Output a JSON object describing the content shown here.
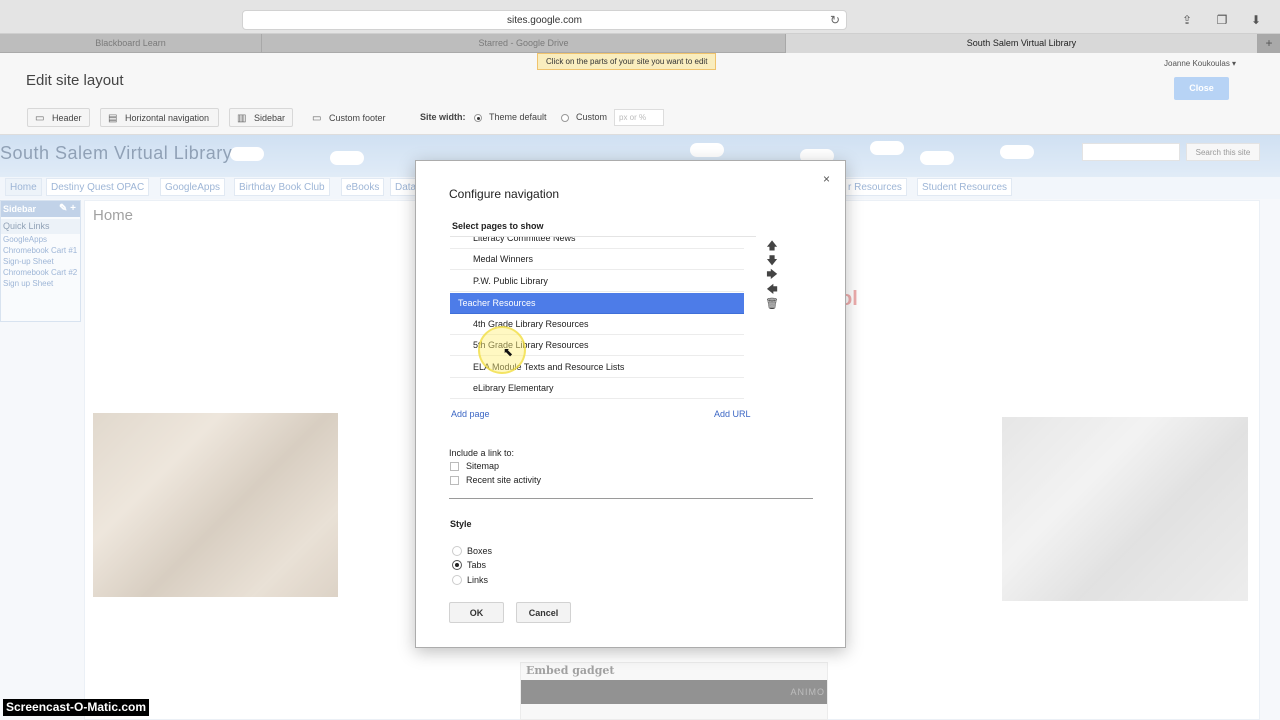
{
  "browser": {
    "url": "sites.google.com",
    "tabs": [
      "Blackboard Learn",
      "Starred - Google Drive",
      "South Salem Virtual Library"
    ],
    "icons": [
      "reload-icon",
      "share-icon",
      "window-icon",
      "download-icon"
    ]
  },
  "edit_bar": {
    "title": "Edit site layout",
    "tooltip": "Click on the parts of your site you want to edit",
    "user": "Joanne Koukoulas ▾",
    "close": "Close",
    "tools": [
      "Header",
      "Horizontal navigation",
      "Sidebar",
      "Custom footer"
    ],
    "site_width_label": "Site width:",
    "width_options": [
      "Theme default",
      "Custom"
    ],
    "width_selected": "Theme default",
    "width_placeholder": "px or %"
  },
  "site": {
    "title": "South Salem Virtual Library",
    "search_button": "Search this site",
    "nav_left": [
      "Home",
      "Destiny Quest OPAC",
      "GoogleApps",
      "Birthday Book Club",
      "eBooks",
      "Data"
    ],
    "nav_right": [
      "r Resources",
      "Student Resources"
    ],
    "sidebar_title": "Sidebar",
    "sidebar_edit": "✎ +",
    "quick_links_title": "Quick Links",
    "quick_links": [
      "GoogleApps",
      "Chromebook Cart #1 Sign-up Sheet",
      "Chromebook Cart #2 Sign up Sheet"
    ],
    "page_title": "Home",
    "fragment": "ol",
    "gadget_title": "Embed gadget",
    "gadget_logo": "ANIMO"
  },
  "dialog": {
    "title": "Configure navigation",
    "close": "×",
    "select_label": "Select pages to show",
    "pages": [
      {
        "label": "Literacy Committee News",
        "selected": false
      },
      {
        "label": "Medal Winners",
        "selected": false
      },
      {
        "label": "P.W. Public Library",
        "selected": false
      },
      {
        "label": "Teacher Resources",
        "selected": true
      },
      {
        "label": "4th Grade Library Resources",
        "selected": false
      },
      {
        "label": "5th Grade Library Resources",
        "selected": false
      },
      {
        "label": "ELA Module Texts and Resource Lists",
        "selected": false
      },
      {
        "label": "eLibrary Elementary",
        "selected": false
      }
    ],
    "arrows": [
      "move-up-icon",
      "move-down-icon",
      "indent-icon",
      "outdent-icon",
      "trash-icon"
    ],
    "add_page": "Add page",
    "add_url": "Add URL",
    "include_label": "Include a link to:",
    "include_options": [
      {
        "label": "Sitemap",
        "checked": false
      },
      {
        "label": "Recent site activity",
        "checked": false
      }
    ],
    "style_label": "Style",
    "style_options": [
      "Boxes",
      "Tabs",
      "Links"
    ],
    "style_selected": "Tabs",
    "ok": "OK",
    "cancel": "Cancel"
  },
  "watermark": "Screencast-O-Matic.com"
}
